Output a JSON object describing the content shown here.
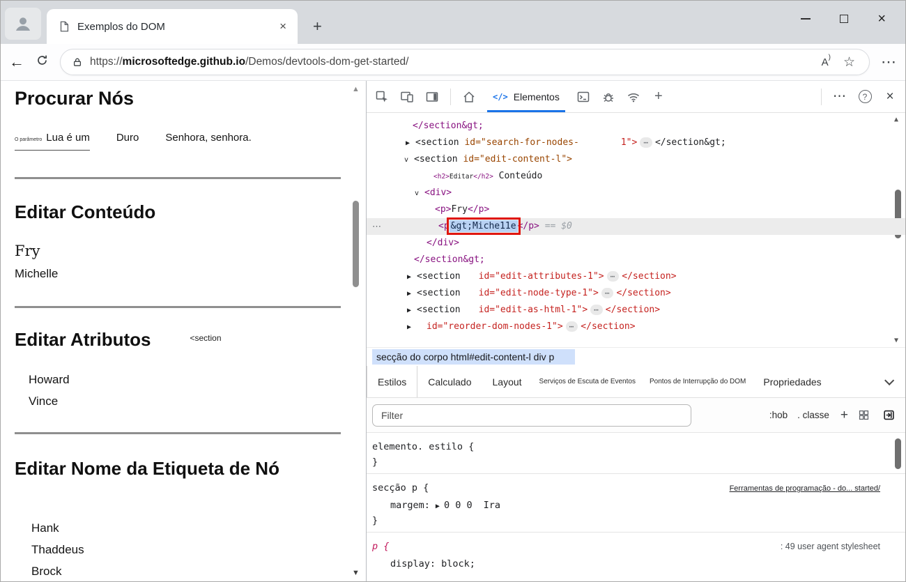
{
  "browser": {
    "tab_title": "Exemplos do DOM",
    "url_scheme": "https://",
    "url_domain": "microsoftedge.github.io",
    "url_path": "/Demos/devtools-dom-get-started/"
  },
  "icons": {
    "close": "×",
    "back": "←",
    "more": "⋯",
    "star": "☆",
    "read_aloud_letter": "A",
    "read_aloud_paren": ")",
    "help": "?",
    "add": "+",
    "new_tab": "+",
    "scroll_up": "▲",
    "scroll_down": "▼",
    "row_menu": "⋯",
    "code": "</>"
  },
  "page": {
    "h1": "Procurar Nós",
    "row_tiny": "O parâmetro",
    "row_items": [
      "Lua é um",
      "Duro",
      "Senhora, senhora."
    ],
    "h2_content": "Editar Conteúdo",
    "content_items": [
      "Fry",
      "Michelle"
    ],
    "h2_attributes": "Editar Atributos",
    "attributes_hint": "<section",
    "attributes_items": [
      "Howard",
      "Vince"
    ],
    "h2_node": "Editar Nome da Etiqueta de Nó",
    "node_items": [
      "Hank",
      "Thaddeus",
      "Brock"
    ]
  },
  "devtools": {
    "elements_tab": "Elementos",
    "breadcrumb": "secção do corpo html#edit-content-l div p",
    "pane_tabs": [
      "Estilos",
      "Calculado",
      "Layout",
      "Serviços de Escuta de Eventos",
      "Pontos de Interrupção do DOM",
      "Propriedades"
    ],
    "filter_placeholder": "Filter",
    "hov_label": ":hob",
    "cls_label": ". classe",
    "dom_lines": [
      {
        "indent": 66,
        "tokens": [
          {
            "c": "tag",
            "t": "</section&gt;"
          }
        ]
      },
      {
        "indent": 56,
        "arrow": "▶",
        "tokens": [
          {
            "c": "dark",
            "t": "<section "
          },
          {
            "c": "attr",
            "t": "id=\"search-for-nodes-"
          },
          {
            "c": "red ml60",
            "t": "1\">"
          },
          {
            "c": "ell",
            "t": "⋯"
          },
          {
            "c": "dark",
            "t": "</section&gt;"
          }
        ]
      },
      {
        "indent": 54,
        "arrow": "v",
        "tokens": [
          {
            "c": "dark",
            "t": "<section "
          },
          {
            "c": "attr",
            "t": "id=\"edit-content-l\">"
          }
        ]
      },
      {
        "indent": 96,
        "tokens": [
          {
            "c": "tag sm",
            "t": "<h2>"
          },
          {
            "c": "dark sm",
            "t": "Editar"
          },
          {
            "c": "tag sm",
            "t": "</h2>"
          },
          {
            "c": "dark",
            "t": " Conteúdo"
          }
        ]
      },
      {
        "indent": 69,
        "arrow": "v",
        "tokens": [
          {
            "c": "tag",
            "t": "<div>"
          }
        ]
      },
      {
        "indent": 98,
        "tokens": [
          {
            "c": "tag",
            "t": "<p>"
          },
          {
            "c": "dark",
            "t": "Fry"
          },
          {
            "c": "tag",
            "t": "</p>"
          }
        ]
      },
      {
        "indent": 103,
        "selected": true,
        "left_ellipsis": true,
        "tokens": [
          {
            "c": "tag",
            "t": "<p"
          },
          {
            "c": "sel",
            "t": "&gt;Miche11e"
          },
          {
            "c": "tag",
            "t": "</p>"
          },
          {
            "c": "anno",
            "t": " == $0"
          }
        ]
      },
      {
        "indent": 86,
        "tokens": [
          {
            "c": "tag",
            "t": "</div>"
          }
        ]
      },
      {
        "indent": 68,
        "tokens": [
          {
            "c": "tag",
            "t": "</section&gt;"
          }
        ]
      },
      {
        "indent": 58,
        "arrow": "▶",
        "tokens": [
          {
            "c": "dark",
            "t": "<section"
          },
          {
            "c": "red ml26",
            "t": "id=\"edit-attributes-1\">"
          },
          {
            "c": "ell",
            "t": "⋯"
          },
          {
            "c": "red",
            "t": "</section>"
          }
        ]
      },
      {
        "indent": 58,
        "arrow": "▶",
        "tokens": [
          {
            "c": "dark",
            "t": "<section"
          },
          {
            "c": "red ml26",
            "t": "id=\"edit-node-type-1\">"
          },
          {
            "c": "ell",
            "t": "⋯"
          },
          {
            "c": "red",
            "t": "</section>"
          }
        ]
      },
      {
        "indent": 58,
        "arrow": "▶",
        "tokens": [
          {
            "c": "dark",
            "t": "<section"
          },
          {
            "c": "red ml26",
            "t": "id=\"edit-as-html-1\">"
          },
          {
            "c": "ell",
            "t": "⋯"
          },
          {
            "c": "red",
            "t": "</section>"
          }
        ]
      },
      {
        "indent": 58,
        "arrow": "▶",
        "tokens": [
          {
            "c": "red ml14",
            "t": "id=\"reorder-dom-nodes-1\">"
          },
          {
            "c": "ell",
            "t": "⋯"
          },
          {
            "c": "red",
            "t": "</section>"
          }
        ]
      }
    ],
    "rules": [
      {
        "selector": "elemento. estilo {",
        "props": [],
        "close": "}"
      },
      {
        "selector": "secção p {",
        "link": "Ferramentas de programação - do... started/",
        "props": [
          {
            "name": "margem:",
            "arrow": "▶",
            "value": "0 0 0",
            "extra": "Ira"
          }
        ],
        "close": "}"
      },
      {
        "selector": "p {",
        "selector_class": "magenta",
        "meta": ": 49 user agent stylesheet",
        "props": [
          {
            "name": "display:",
            "value": " block;"
          }
        ],
        "close": ""
      }
    ]
  }
}
